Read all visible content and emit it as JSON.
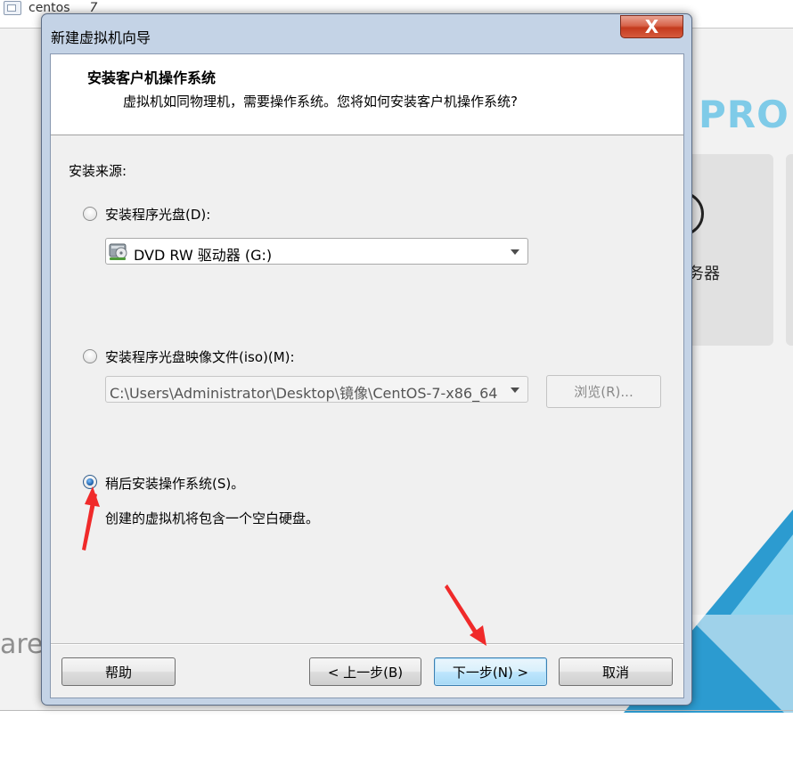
{
  "background": {
    "tab_label": "centos",
    "tab_marker": "7",
    "brand_fragment": "PRO",
    "card_text": "务器",
    "logo_fragment": "are"
  },
  "dialog": {
    "title": "新建虚拟机向导",
    "close_symbol": "X",
    "header": {
      "title": "安装客户机操作系统",
      "subtitle": "虚拟机如同物理机，需要操作系统。您将如何安装客户机操作系统?"
    },
    "install_source_label": "安装来源:",
    "option_disc": {
      "label": "安装程序光盘(D):",
      "checked": false,
      "drive_value": "DVD RW 驱动器 (G:)"
    },
    "option_iso": {
      "label": "安装程序光盘映像文件(iso)(M):",
      "checked": false,
      "path_value": "C:\\Users\\Administrator\\Desktop\\镜像\\CentOS-7-x86_64",
      "browse_label": "浏览(R)..."
    },
    "option_later": {
      "label": "稍后安装操作系统(S)。",
      "checked": true,
      "description": "创建的虚拟机将包含一个空白硬盘。"
    },
    "buttons": {
      "help": "帮助",
      "back": "< 上一步(B)",
      "next": "下一步(N) >",
      "cancel": "取消"
    }
  },
  "colors": {
    "annotation_arrow": "#f02a2a",
    "accent_blue": "#2c9bd0"
  }
}
